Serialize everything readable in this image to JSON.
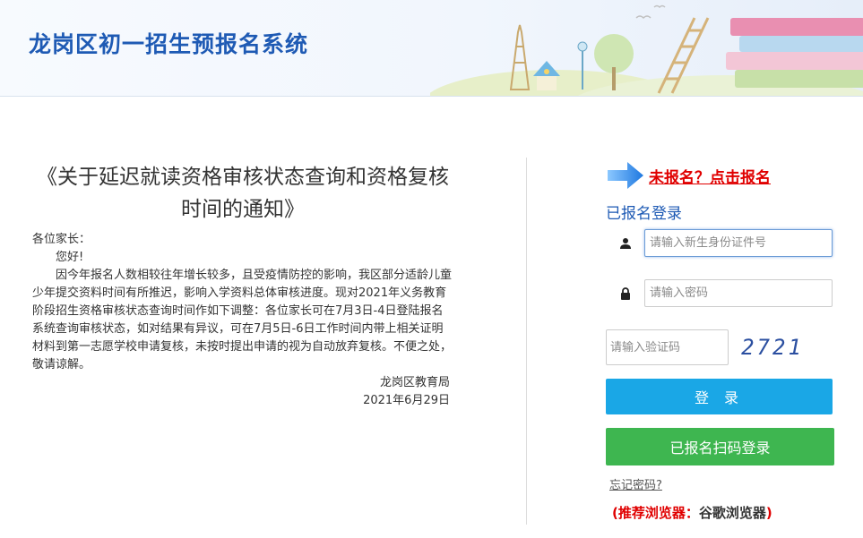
{
  "header": {
    "title": "龙岗区初一招生预报名系统"
  },
  "notice": {
    "title": "《关于延迟就读资格审核状态查询和资格复核时间的通知》",
    "greeting": "各位家长：",
    "hello": "您好!",
    "paragraph": "因今年报名人数相较往年增长较多，且受疫情防控的影响，我区部分适龄儿童少年提交资料时间有所推迟，影响入学资料总体审核进度。现对2021年义务教育阶段招生资格审核状态查询时间作如下调整：各位家长可在7月3日-4日登陆报名系统查询审核状态，如对结果有异议，可在7月5日-6日工作时间内带上相关证明材料到第一志愿学校申请复核，未按时提出申请的视为自动放弃复核。不便之处，敬请谅解。",
    "signer": "龙岗区教育局",
    "date": "2021年6月29日"
  },
  "login": {
    "register_link": "未报名？点击报名",
    "section_label": "已报名登录",
    "id_placeholder": "请输入新生身份证件号",
    "password_placeholder": "请输入密码",
    "captcha_placeholder": "请输入验证码",
    "captcha_code": "2721",
    "login_button": "登 录",
    "scan_button": "已报名扫码登录",
    "forgot_link": "忘记密码?",
    "browser_tip_prefix": "(推荐浏览器：",
    "browser_name": "谷歌浏览器",
    "browser_tip_suffix": ")"
  },
  "icons": {
    "arrow": "arrow-right-icon",
    "user": "user-icon",
    "lock": "lock-icon"
  },
  "colors": {
    "title_blue": "#1e5ab4",
    "login_button": "#1aa7e6",
    "scan_button": "#3eb650",
    "warning_red": "#e00000"
  }
}
